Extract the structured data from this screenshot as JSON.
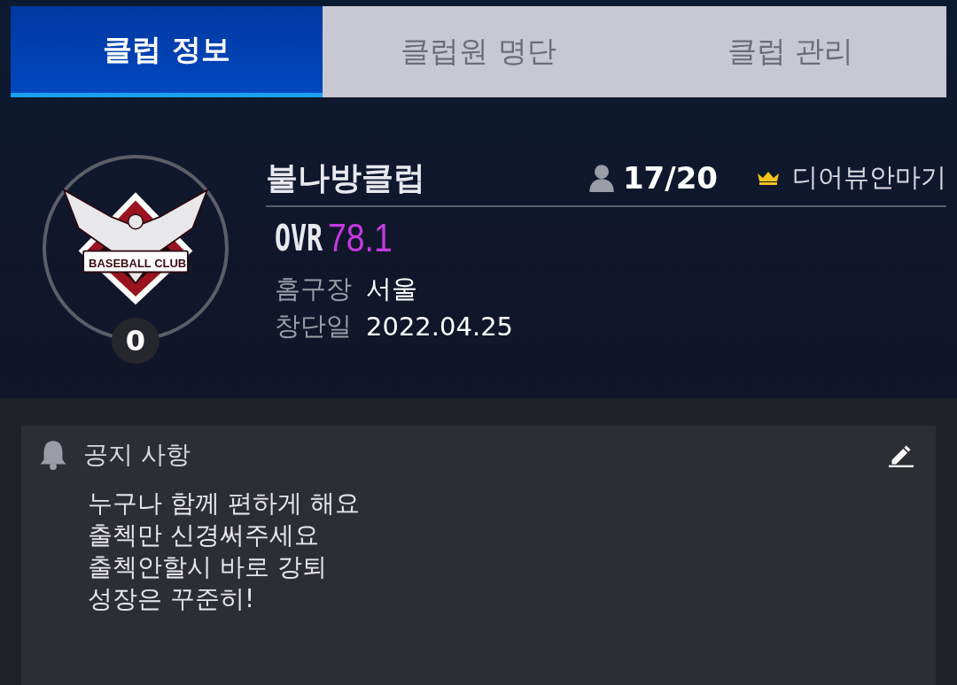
{
  "tabs": [
    {
      "label": "클럽 정보",
      "selected": true
    },
    {
      "label": "클럽원 명단",
      "selected": false
    },
    {
      "label": "클럽 관리",
      "selected": false
    }
  ],
  "club": {
    "emblem_text": "BASEBALL CLUB",
    "badge": "0",
    "name": "불나방클럽",
    "members": "17/20",
    "leader": "디어뷰안마기",
    "ovr_label": "OVR",
    "ovr_value": "78.1",
    "info": [
      {
        "label": "홈구장",
        "value": "서울"
      },
      {
        "label": "창단일",
        "value": "2022.04.25"
      }
    ]
  },
  "notice": {
    "title": "공지 사항",
    "lines": [
      "누구나 함께 편하게 해요",
      "출첵만 신경써주세요",
      "출첵안할시 바로 강퇴",
      "성장은 꾸준히!"
    ]
  }
}
